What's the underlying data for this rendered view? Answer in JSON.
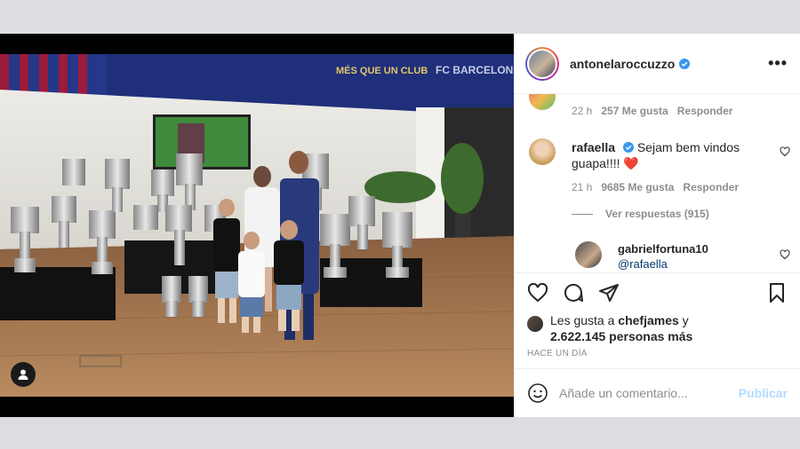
{
  "post": {
    "username": "antonelaroccuzzo",
    "verified": true,
    "more_label": "•••"
  },
  "photo": {
    "banner_left": "MÉS QUE UN CLUB",
    "banner_right": "FC BARCELONA"
  },
  "comments": [
    {
      "meta_time": "22 h",
      "meta_likes": "257 Me gusta",
      "meta_reply": "Responder"
    },
    {
      "username": "rafaella",
      "verified": true,
      "text_line1": "Sejam bem vindos",
      "text_line2": "guapa!!!!",
      "emoji": "❤️",
      "meta_time": "21 h",
      "meta_likes": "9685 Me gusta",
      "meta_reply": "Responder",
      "replies_label": "Ver respuestas (915)",
      "reply": {
        "username": "gabrielfortuna10",
        "mention": "@rafaella"
      }
    }
  ],
  "likes": {
    "prefix": "Les gusta a",
    "user": "chefjames",
    "joiner": "y",
    "count_text": "2.622.145 personas más"
  },
  "time_ago": "HACE UN DÍA",
  "add_comment": {
    "placeholder": "Añade un comentario...",
    "publish": "Publicar"
  },
  "colors": {
    "verified_blue": "#3897f0",
    "heart_red": "#ed4956",
    "publish_disabled": "#b3dbff"
  },
  "icons": [
    "heart-icon",
    "comment-icon",
    "share-icon",
    "bookmark-icon",
    "emoji-icon",
    "more-icon",
    "user-tag-icon",
    "verified-badge-icon"
  ]
}
